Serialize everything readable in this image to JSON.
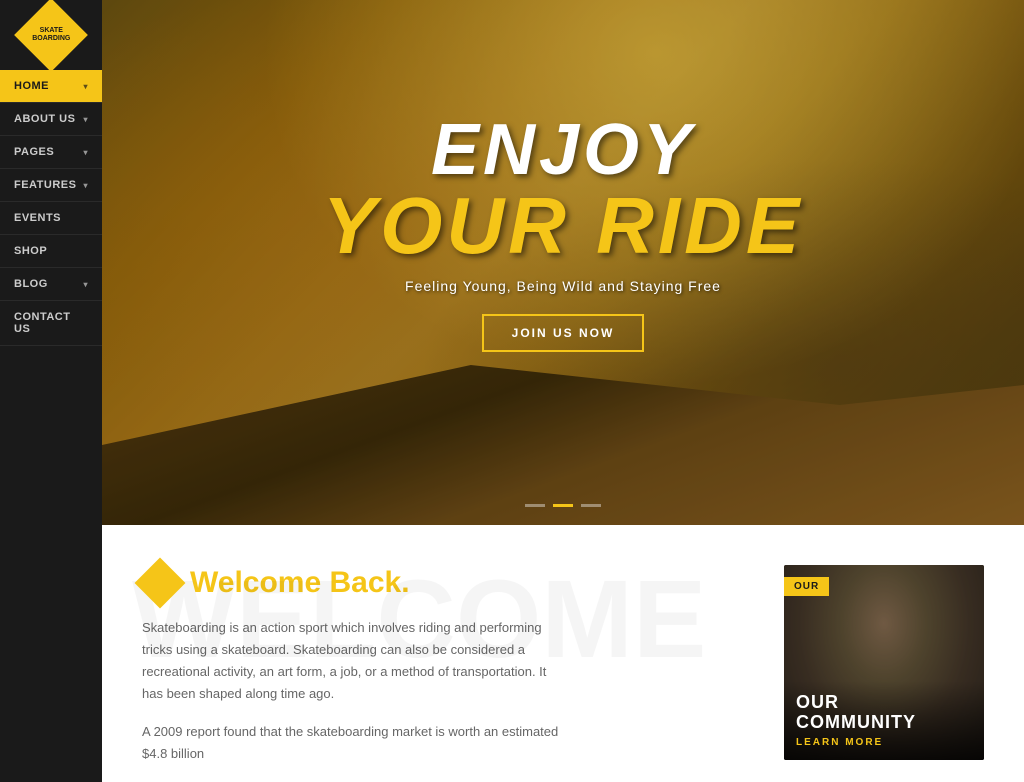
{
  "logo": {
    "line1": "Skate",
    "line2": "BOARDING"
  },
  "nav": {
    "items": [
      {
        "id": "home",
        "label": "HOME",
        "active": true,
        "hasArrow": true
      },
      {
        "id": "about-us",
        "label": "ABOUT US",
        "active": false,
        "hasArrow": true
      },
      {
        "id": "pages",
        "label": "PAGES",
        "active": false,
        "hasArrow": true
      },
      {
        "id": "features",
        "label": "FEATURES",
        "active": false,
        "hasArrow": true
      },
      {
        "id": "events",
        "label": "EVENTS",
        "active": false,
        "hasArrow": false
      },
      {
        "id": "shop",
        "label": "SHOP",
        "active": false,
        "hasArrow": false
      },
      {
        "id": "blog",
        "label": "BLOG",
        "active": false,
        "hasArrow": true
      },
      {
        "id": "contact-us",
        "label": "CONTACT US",
        "active": false,
        "hasArrow": false
      }
    ]
  },
  "hero": {
    "title_line1": "ENJOY",
    "title_line2": "YOUR RIDE",
    "subtitle": "Feeling Young, Being Wild and Staying Free",
    "cta_button": "JOIN US NOW",
    "dots": [
      {
        "active": false
      },
      {
        "active": true
      },
      {
        "active": false
      }
    ]
  },
  "welcome": {
    "title": "Welcome Back",
    "title_dot": ".",
    "bg_text": "Welcome",
    "desc1": "Skateboarding is an action sport which involves riding and performing tricks using a skateboard. Skateboarding can also be considered a recreational activity, an art form, a job, or a method of transportation. It has been shaped along time ago.",
    "desc2": "A 2009 report found that the skateboarding market is worth an estimated $4.8 billion"
  },
  "community": {
    "tag": "OUR",
    "label_line1": "OUR",
    "label_line2": "COMMUNITY",
    "learn_more": "LEARN MORE"
  }
}
